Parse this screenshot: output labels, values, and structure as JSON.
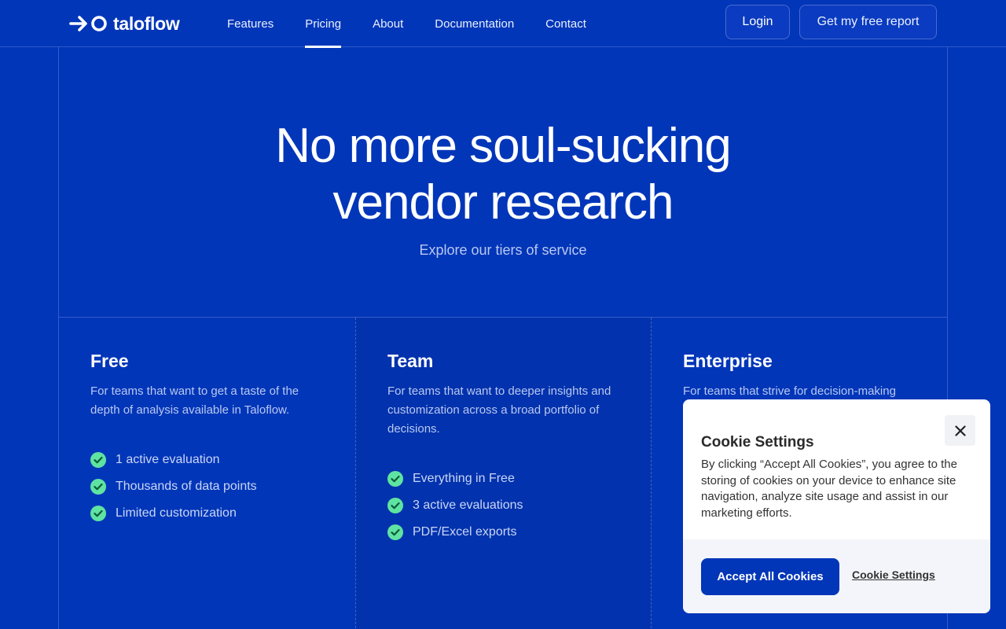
{
  "brand": {
    "name": "taloflow"
  },
  "nav": {
    "links": [
      {
        "label": "Features"
      },
      {
        "label": "Pricing",
        "active": true
      },
      {
        "label": "About"
      },
      {
        "label": "Documentation"
      },
      {
        "label": "Contact"
      }
    ],
    "login_label": "Login",
    "report_label": "Get my free report"
  },
  "hero": {
    "title_line1": "No more soul-sucking",
    "title_line2": "vendor research",
    "subtitle": "Explore our tiers of service"
  },
  "plans": [
    {
      "name": "Free",
      "description": "For teams that want to get a taste of the depth of analysis available in Taloflow.",
      "features": [
        "1 active evaluation",
        "Thousands of data points",
        "Limited customization"
      ]
    },
    {
      "name": "Team",
      "description": "For teams that want to deeper insights and customization across a broad portfolio of decisions.",
      "features": [
        "Everything in Free",
        "3 active evaluations",
        "PDF/Excel exports"
      ]
    },
    {
      "name": "Enterprise",
      "description": "For teams that strive for decision-making",
      "features": []
    }
  ],
  "cookie": {
    "title": "Cookie Settings",
    "text": "By clicking “Accept All Cookies”, you agree to the storing of cookies on your device to enhance site navigation, analyze site usage and assist in our marketing efforts.",
    "accept_label": "Accept All Cookies",
    "settings_label": "Cookie Settings"
  },
  "colors": {
    "background": "#0236b9",
    "highlight_column": "#0232ad",
    "check": "#5fe3a1",
    "cookie_accept": "#0236b9"
  },
  "icons": {
    "logo": "arrow-ring-logo-icon",
    "feature": "check-circle-icon",
    "close": "close-icon"
  }
}
